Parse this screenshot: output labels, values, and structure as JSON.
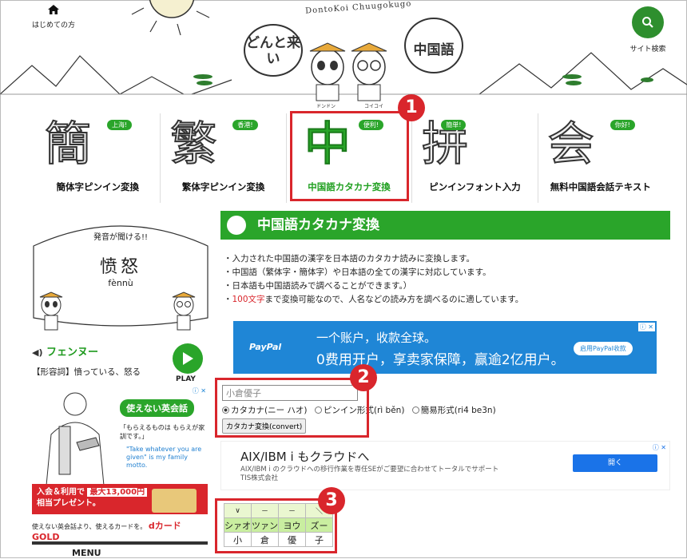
{
  "header": {
    "home_label": "はじめての方",
    "search_label": "サイト検索",
    "brand": "DontoKoi Chuugokugo",
    "bubble_left": "どんと来い",
    "bubble_right": "中国語",
    "mascot_left": "ドンドン",
    "mascot_right": "コイコイ"
  },
  "nav": [
    {
      "kanji": "簡",
      "tag": "上海!",
      "label": "簡体字ピンイン変換"
    },
    {
      "kanji": "繁",
      "tag": "香港!",
      "label": "繁体字ピンイン変換"
    },
    {
      "kanji": "中",
      "tag": "便利!",
      "label": "中国語カタカナ変換"
    },
    {
      "kanji": "拼",
      "tag": "簡単!",
      "label": "ピンインフォント入力"
    },
    {
      "kanji": "会",
      "tag": "你好!",
      "label": "無料中国語会話テキスト"
    }
  ],
  "badges": [
    "1",
    "2",
    "3"
  ],
  "sidebar": {
    "pron_hint": "発音が聞ける!!",
    "word": "愤怒",
    "pinyin": "fènnù",
    "katakana": "フェンヌー",
    "play_label": "PLAY",
    "definition": "【形容詞】憤っている、怒る",
    "ad_bubble": "使えない英会話",
    "ad_quote": "「もらえるものは もらえが家訓です。」",
    "ad_en": "\"Take whatever you are given\" is my family motto.",
    "ad_red_1": "入会＆利用で",
    "ad_red_hl": "最大13,000円",
    "ad_red_2": "相当プレゼント。",
    "ad_foot_text": "使えない英会話より、使えるカードを。",
    "ad_foot_brand": "dカード GOLD",
    "menu": "MENU"
  },
  "main": {
    "title": "中国語カタカナ変換",
    "desc": [
      "・入力された中国語の漢字を日本語のカタカナ読みに変換します。",
      "・中国語（繁体字・簡体字）や日本語の全ての漢字に対応しています。",
      "・日本語も中国語読みで調べることができます。）"
    ],
    "desc_last_prefix": "・",
    "desc_last_red": "100文字",
    "desc_last_rest": "まで変換可能なので、人名などの読み方を調べるのに適しています。",
    "paypal": {
      "brand": "PayPal",
      "line1": "一个账户，收款全球。",
      "line2": "0费用开户，享卖家保障，赢逾2亿用户。",
      "button": "启用PayPal收款"
    },
    "form": {
      "input_value": "小倉優子",
      "radio1": "カタカナ(ニー ハオ)",
      "radio2": "ピンイン形式(rì běn)",
      "radio3": "簡易形式(ri4 be3n)",
      "button": "カタカナ変換(convert)"
    },
    "aix": {
      "title": "AIX/IBM i もクラウドへ",
      "sub1": "AIX/IBM i のクラウドへの移行作業を専任SEがご要望に合わせてトータルでサポート",
      "sub2": "TIS株式会社",
      "button": "開く"
    },
    "result": {
      "tones": [
        "∨",
        "－",
        "－",
        "＼"
      ],
      "katakana": [
        "シァオ",
        "ツァン",
        "ヨウ",
        "ズー"
      ],
      "hanzi": [
        "小",
        "倉",
        "優",
        "子"
      ]
    }
  }
}
